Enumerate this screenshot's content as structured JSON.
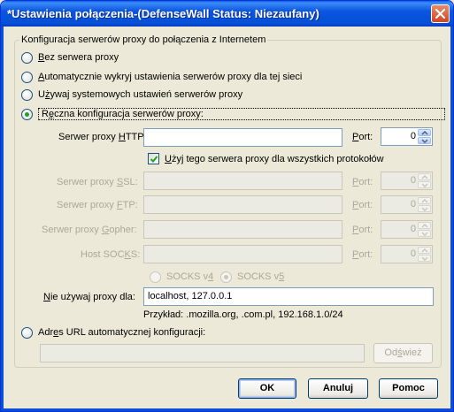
{
  "window": {
    "title": "*Ustawienia połączenia-(DefenseWall Status: Niezaufany)",
    "colors": {
      "titlebar": "#0450d6",
      "face": "#ece9d8",
      "radio_dot": "#21a121",
      "checkmark": "#21a121"
    }
  },
  "group": {
    "legend": "Konfiguracja serwerów proxy do połączenia z Internetem"
  },
  "options": {
    "no_proxy": {
      "pre": "",
      "accel": "B",
      "post": "ez serwera proxy",
      "checked": false
    },
    "autodetect": {
      "pre": "",
      "accel": "A",
      "post": "utomatycznie wykryj ustawienia serwerów proxy dla tej sieci",
      "checked": false
    },
    "system": {
      "pre": "U",
      "accel": "ż",
      "post": "ywaj systemowych ustawień serwerów proxy",
      "checked": false
    },
    "manual": {
      "pre": "R",
      "accel": "ę",
      "post": "czna konfiguracja serwerów proxy:",
      "checked": true
    },
    "auto_url": {
      "pre": "Adr",
      "accel": "e",
      "post": "s URL automatycznej konfiguracji:",
      "checked": false
    }
  },
  "http": {
    "pre": "Serwer proxy ",
    "accel": "H",
    "post": "TTP:",
    "value": "",
    "port_pre": "",
    "port_accel": "P",
    "port_post": "ort:",
    "port_value": "0"
  },
  "same_for_all": {
    "pre": "",
    "accel": "U",
    "post": "żyj tego serwera proxy dla wszystkich protokołów",
    "checked": true
  },
  "ssl": {
    "pre": "Serwer proxy ",
    "accel": "S",
    "post": "SL:",
    "port_pre": "",
    "port_accel": "P",
    "port_post": "ort:",
    "port_value": "0"
  },
  "ftp": {
    "pre": "Serwer proxy ",
    "accel": "F",
    "post": "TP:",
    "port_pre": "",
    "port_accel": "P",
    "port_post": "ort:",
    "port_value": "0"
  },
  "gopher": {
    "pre": "Serwer proxy ",
    "accel": "G",
    "post": "opher:",
    "port_pre": "",
    "port_accel": "P",
    "port_post": "ort:",
    "port_value": "0"
  },
  "socks": {
    "pre": "Host SOC",
    "accel": "K",
    "post": "S:",
    "port_pre": "",
    "port_accel": "P",
    "port_post": "ort:",
    "port_value": "0"
  },
  "socks_version": {
    "v4": {
      "pre": "SOCKS v",
      "accel": "4",
      "post": "",
      "checked": false
    },
    "v5": {
      "pre": "SOCKS v",
      "accel": "5",
      "post": "",
      "checked": true
    }
  },
  "no_proxy_for": {
    "pre": "",
    "accel": "N",
    "post": "ie używaj proxy dla:",
    "value": "localhost, 127.0.0.1",
    "example": "Przykład: .mozilla.org, .com.pl, 192.168.1.0/24"
  },
  "auto_url_field": {
    "value": ""
  },
  "buttons": {
    "reload": {
      "pre": "Od",
      "accel": "ś",
      "post": "wież"
    },
    "ok": "OK",
    "cancel": "Anuluj",
    "help": "Pomoc"
  }
}
